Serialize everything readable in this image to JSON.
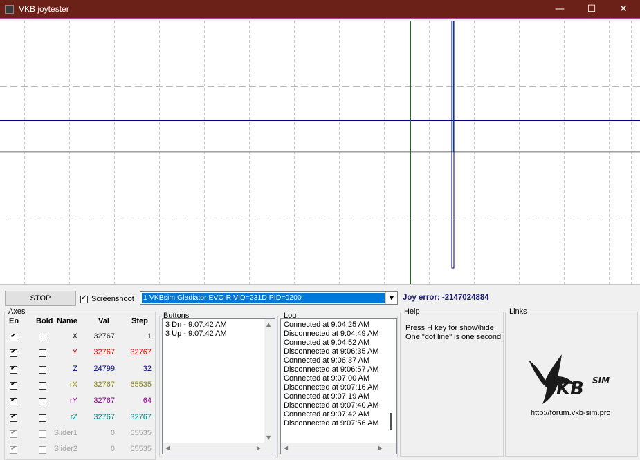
{
  "window": {
    "title": "VKB joytester",
    "minimize_glyph": "—",
    "maximize_glyph": "☐",
    "close_glyph": "✕"
  },
  "toolbar": {
    "stop_label": "STOP",
    "screenshoot_label": "Screenshoot",
    "screenshoot_checked": true,
    "device_selected": "1  VKBsim Gladiator EVO R   VID=231D PID=0200",
    "joy_error": "Joy error: -2147024884"
  },
  "axes": {
    "group_label": "Axes",
    "headers": {
      "en": "En",
      "bold": "Bold",
      "name": "Name",
      "val": "Val",
      "step": "Step"
    },
    "rows": [
      {
        "name": "X",
        "val": "32767",
        "step": "1",
        "enabled": true,
        "bold": false,
        "disabled": false,
        "color": "#1a1a1a"
      },
      {
        "name": "Y",
        "val": "32767",
        "step": "32767",
        "enabled": true,
        "bold": false,
        "disabled": false,
        "color": "#e00000"
      },
      {
        "name": "Z",
        "val": "24799",
        "step": "32",
        "enabled": true,
        "bold": false,
        "disabled": false,
        "color": "#00007f"
      },
      {
        "name": "rX",
        "val": "32767",
        "step": "65535",
        "enabled": true,
        "bold": false,
        "disabled": false,
        "color": "#8a8a00"
      },
      {
        "name": "rY",
        "val": "32767",
        "step": "64",
        "enabled": true,
        "bold": false,
        "disabled": false,
        "color": "#8a008a"
      },
      {
        "name": "rZ",
        "val": "32767",
        "step": "32767",
        "enabled": true,
        "bold": false,
        "disabled": false,
        "color": "#008080"
      },
      {
        "name": "Slider1",
        "val": "0",
        "step": "65535",
        "enabled": true,
        "bold": false,
        "disabled": true,
        "color": "#a0a0a0"
      },
      {
        "name": "Slider2",
        "val": "0",
        "step": "65535",
        "enabled": true,
        "bold": false,
        "disabled": true,
        "color": "#a0a0a0"
      }
    ]
  },
  "buttons": {
    "group_label": "Buttons",
    "items": [
      "3 Dn - 9:07:42 AM",
      "3 Up - 9:07:42 AM"
    ]
  },
  "log": {
    "group_label": "Log",
    "items": [
      "Connected at 9:04:25 AM",
      "Disconnected at 9:04:49 AM",
      "Connected at 9:04:52 AM",
      "Disconnected at 9:06:35 AM",
      "Connected at 9:06:37 AM",
      "Disconnected at 9:06:57 AM",
      "Connected at 9:07:00 AM",
      "Disconnected at 9:07:16 AM",
      "Connected at 9:07:19 AM",
      "Disconnected at 9:07:40 AM",
      "Connected at 9:07:42 AM",
      "Disconnected at 9:07:56 AM"
    ]
  },
  "help": {
    "group_label": "Help",
    "line1": "Press H key for show\\hide",
    "line2": "One \"dot line\" is one second"
  },
  "links": {
    "group_label": "Links",
    "logo_text": "VKBsim",
    "url": "http://forum.vkb-sim.pro"
  },
  "colors": {
    "titlebar": "#6b2118",
    "accent": "#0078d7",
    "plot_x": "#00007f",
    "plot_green": "#008000",
    "plot_teal": "#008080",
    "joy_error": "#1a1a6e"
  }
}
